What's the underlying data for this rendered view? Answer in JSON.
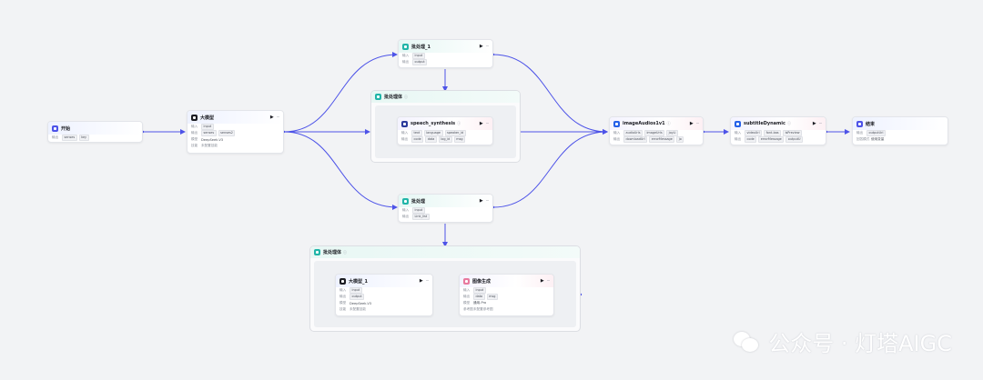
{
  "nodes": {
    "start": {
      "title": "开始",
      "input_label": "输出",
      "params": [
        "senses",
        "key"
      ]
    },
    "llm": {
      "title": "大模型",
      "input_label": "输入",
      "output_label": "输出",
      "model_label": "模型",
      "skill_label": "技能",
      "inputs": [
        "input"
      ],
      "outputs": [
        "senses",
        "senses2"
      ],
      "model": "DeepSeek-V3",
      "skill": "未配置技能"
    },
    "batch1_top": {
      "title": "批处理_1",
      "input_label": "输入",
      "output_label": "输出",
      "inputs": [
        "input"
      ],
      "outputs": [
        "output"
      ]
    },
    "speech": {
      "title": "speech_synthesis",
      "input_label": "输入",
      "output_label": "输出",
      "inputs": [
        "text",
        "language",
        "speaker_id"
      ],
      "outputs": [
        "code",
        "data",
        "log_id",
        "msg"
      ]
    },
    "batch_mid": {
      "title": "批处理",
      "input_label": "输入",
      "output_label": "输出",
      "inputs": [
        "input"
      ],
      "outputs": [
        "Link_list"
      ]
    },
    "llm1": {
      "title": "大模型_1",
      "input_label": "输入",
      "output_label": "输出",
      "model_label": "模型",
      "skill_label": "技能",
      "inputs": [
        "input"
      ],
      "outputs": [
        "output"
      ],
      "model": "DeepSeek-V3",
      "skill": "未配置技能"
    },
    "image": {
      "title": "图像生成",
      "input_label": "输入",
      "output_label": "输出",
      "model_label": "模型",
      "ref_label": "参考图",
      "inputs": [
        "input"
      ],
      "outputs": [
        "data",
        "msg"
      ],
      "model": "通用-Pro",
      "ref": "未配置参考图"
    },
    "imgaudio": {
      "title": "imageAudios1v1",
      "input_label": "输入",
      "output_label": "输出",
      "inputs": [
        "audioUrls",
        "imageUrls",
        "joyLi"
      ],
      "outputs": [
        "downloadUrl",
        "errorMessage",
        "jo"
      ]
    },
    "subtitle": {
      "title": "subtitleDynamic",
      "input_label": "输入",
      "output_label": "输出",
      "inputs": [
        "videoUrl",
        "font-bas",
        "isPreview"
      ],
      "outputs": [
        "code",
        "errorMessage",
        "outputU"
      ]
    },
    "end": {
      "title": "结束",
      "input_label": "输出",
      "mode_label": "回答模式",
      "params": [
        "outputUrl"
      ],
      "mode": "使用变量"
    }
  },
  "groups": {
    "batch_body": {
      "title": "批处理体"
    },
    "loop_body": {
      "title": "批处理体"
    }
  },
  "watermark": {
    "text": "公众号 · 灯塔AIGC"
  },
  "icons": {
    "play": "▶",
    "more": "···",
    "info": "ⓘ"
  }
}
